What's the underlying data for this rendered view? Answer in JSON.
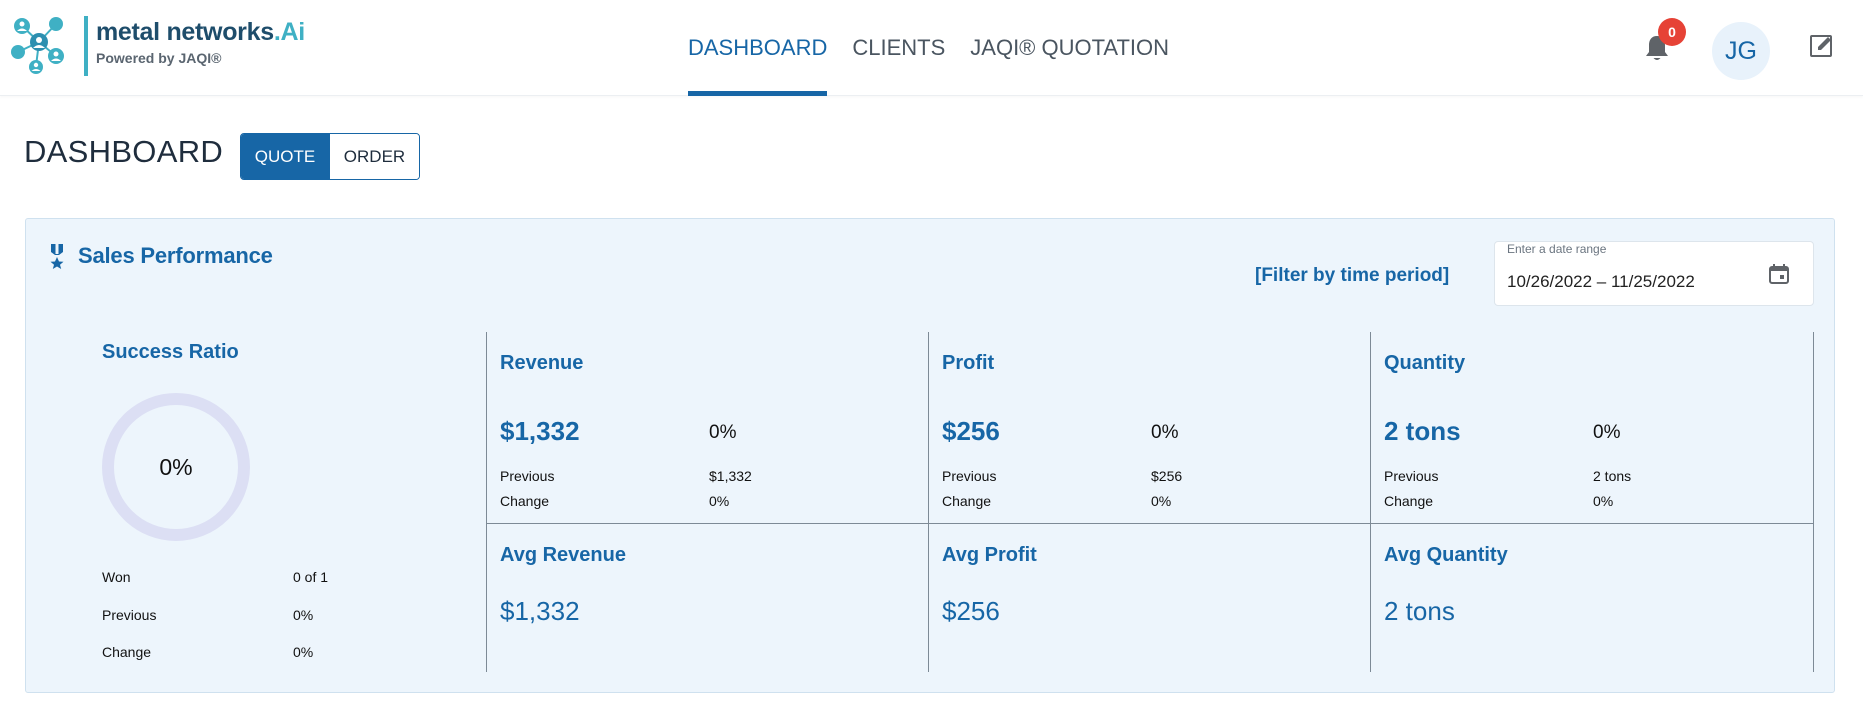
{
  "brand": {
    "name": "metal networks",
    "name_suffix": ".Ai",
    "subtitle": "Powered by JAQI®",
    "colors": {
      "primary": "#1766a6",
      "accent": "#3fb0c4",
      "badge": "#e64236"
    }
  },
  "nav": {
    "items": [
      {
        "label": "DASHBOARD",
        "active": true
      },
      {
        "label": "CLIENTS",
        "active": false
      },
      {
        "label": "JAQI® QUOTATION",
        "active": false
      }
    ]
  },
  "header": {
    "notification_icon": "bell-icon",
    "notification_count": "0",
    "user_initials": "JG",
    "edit_icon": "edit-note-icon"
  },
  "page": {
    "title": "DASHBOARD",
    "toggle": [
      {
        "label": "QUOTE",
        "active": true
      },
      {
        "label": "ORDER",
        "active": false
      }
    ]
  },
  "sales": {
    "icon": "medal-icon",
    "title": "Sales Performance",
    "filter_link": "[Filter by time period]",
    "date_range": {
      "label": "Enter a date range",
      "value": "10/26/2022 – 11/25/2022",
      "icon": "calendar-icon"
    },
    "success_ratio": {
      "title": "Success Ratio",
      "value": "0%",
      "ratio": 0,
      "rows": [
        {
          "label": "Won",
          "value": "0 of 1"
        },
        {
          "label": "Previous",
          "value": "0%"
        },
        {
          "label": "Change",
          "value": "0%"
        }
      ]
    },
    "metrics": [
      {
        "title": "Revenue",
        "value": "$1,332",
        "pct": "0%",
        "previous_label": "Previous",
        "previous": "$1,332",
        "change_label": "Change",
        "change": "0%",
        "avg_title": "Avg Revenue",
        "avg_value": "$1,332"
      },
      {
        "title": "Profit",
        "value": "$256",
        "pct": "0%",
        "previous_label": "Previous",
        "previous": "$256",
        "change_label": "Change",
        "change": "0%",
        "avg_title": "Avg Profit",
        "avg_value": "$256"
      },
      {
        "title": "Quantity",
        "value": "2 tons",
        "pct": "0%",
        "previous_label": "Previous",
        "previous": "2 tons",
        "change_label": "Change",
        "change": "0%",
        "avg_title": "Avg Quantity",
        "avg_value": "2 tons"
      }
    ]
  }
}
